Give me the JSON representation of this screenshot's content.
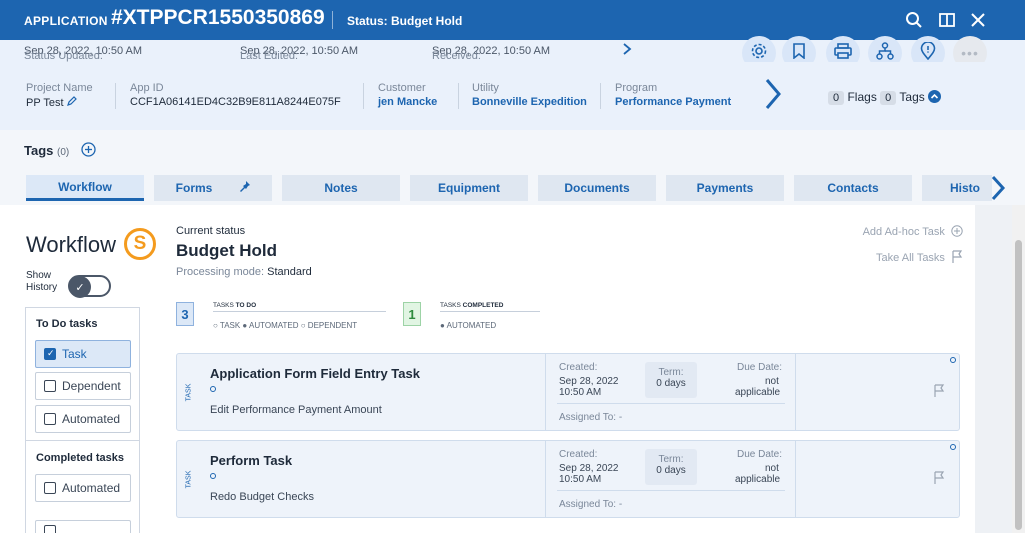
{
  "header": {
    "app_label": "APPLICATION",
    "app_id": "#XTPPCR1550350869",
    "status": "Status: Budget Hold",
    "icons": [
      "search-icon",
      "split-view-icon",
      "close-icon"
    ]
  },
  "subbar": {
    "status_updated_label": "Status Updated:",
    "status_updated_value": "Sep 28, 2022, 10:50 AM",
    "last_edited_label": "Last Edited:",
    "last_edited_value": "Sep 28, 2022, 10:50 AM",
    "received_label": "Received:",
    "received_value": "Sep 28, 2022, 10:50 AM"
  },
  "info": {
    "project_name_label": "Project Name",
    "project_name": "PP Test",
    "app_id_label": "App ID",
    "app_id": "CCF1A06141ED4C32B9E811A8244E075F",
    "customer_label": "Customer",
    "customer": "jen Mancke",
    "utility_label": "Utility",
    "utility": "Bonneville Expedition",
    "program_label": "Program",
    "program": "Performance Payment",
    "flags_count": "0",
    "flags_label": "Flags",
    "tags_count": "0",
    "tags_label": "Tags"
  },
  "tags_row": {
    "label": "Tags",
    "count": "(0)"
  },
  "tabs": [
    "Workflow",
    "Forms",
    "Notes",
    "Equipment",
    "Documents",
    "Payments",
    "Contacts",
    "Histo"
  ],
  "sidebar": {
    "title": "Workflow",
    "badge": "S",
    "show_history": "Show History",
    "todo_header": "To Do tasks",
    "todo_filters": [
      "Task",
      "Dependent",
      "Automated"
    ],
    "completed_header": "Completed tasks",
    "completed_filters": [
      "Automated"
    ]
  },
  "main": {
    "current_status_label": "Current status",
    "current_status": "Budget Hold",
    "processing_mode_label": "Processing mode:",
    "processing_mode": "Standard",
    "add_adhoc": "Add Ad-hoc Task",
    "take_all": "Take All Tasks",
    "todo_count": "3",
    "todo_head_a": "TASKS",
    "todo_head_b": "TO DO",
    "todo_legend": "○ TASK  ● AUTOMATED  ○ DEPENDENT",
    "done_count": "1",
    "done_head_a": "TASKS",
    "done_head_b": "COMPLETED",
    "done_legend": "● AUTOMATED"
  },
  "tasks": [
    {
      "side": "TASK",
      "name": "Application Form Field Entry Task",
      "subtitle": "Edit Performance Payment Amount",
      "created_label": "Created:",
      "created": "Sep 28, 2022",
      "created_time": "10:50 AM",
      "term_label": "Term:",
      "term": "0 days",
      "due_label": "Due Date:",
      "due": "not",
      "due2": "applicable",
      "assigned": "Assigned To: -"
    },
    {
      "side": "TASK",
      "name": "Perform Task",
      "subtitle": "Redo Budget Checks",
      "created_label": "Created:",
      "created": "Sep 28, 2022",
      "created_time": "10:50 AM",
      "term_label": "Term:",
      "term": "0 days",
      "due_label": "Due Date:",
      "due": "not",
      "due2": "applicable",
      "assigned": "Assigned To: -"
    }
  ],
  "colors": {
    "brand": "#1d65b0",
    "badge": "#f49b1e",
    "success": "#2e8b3e"
  }
}
